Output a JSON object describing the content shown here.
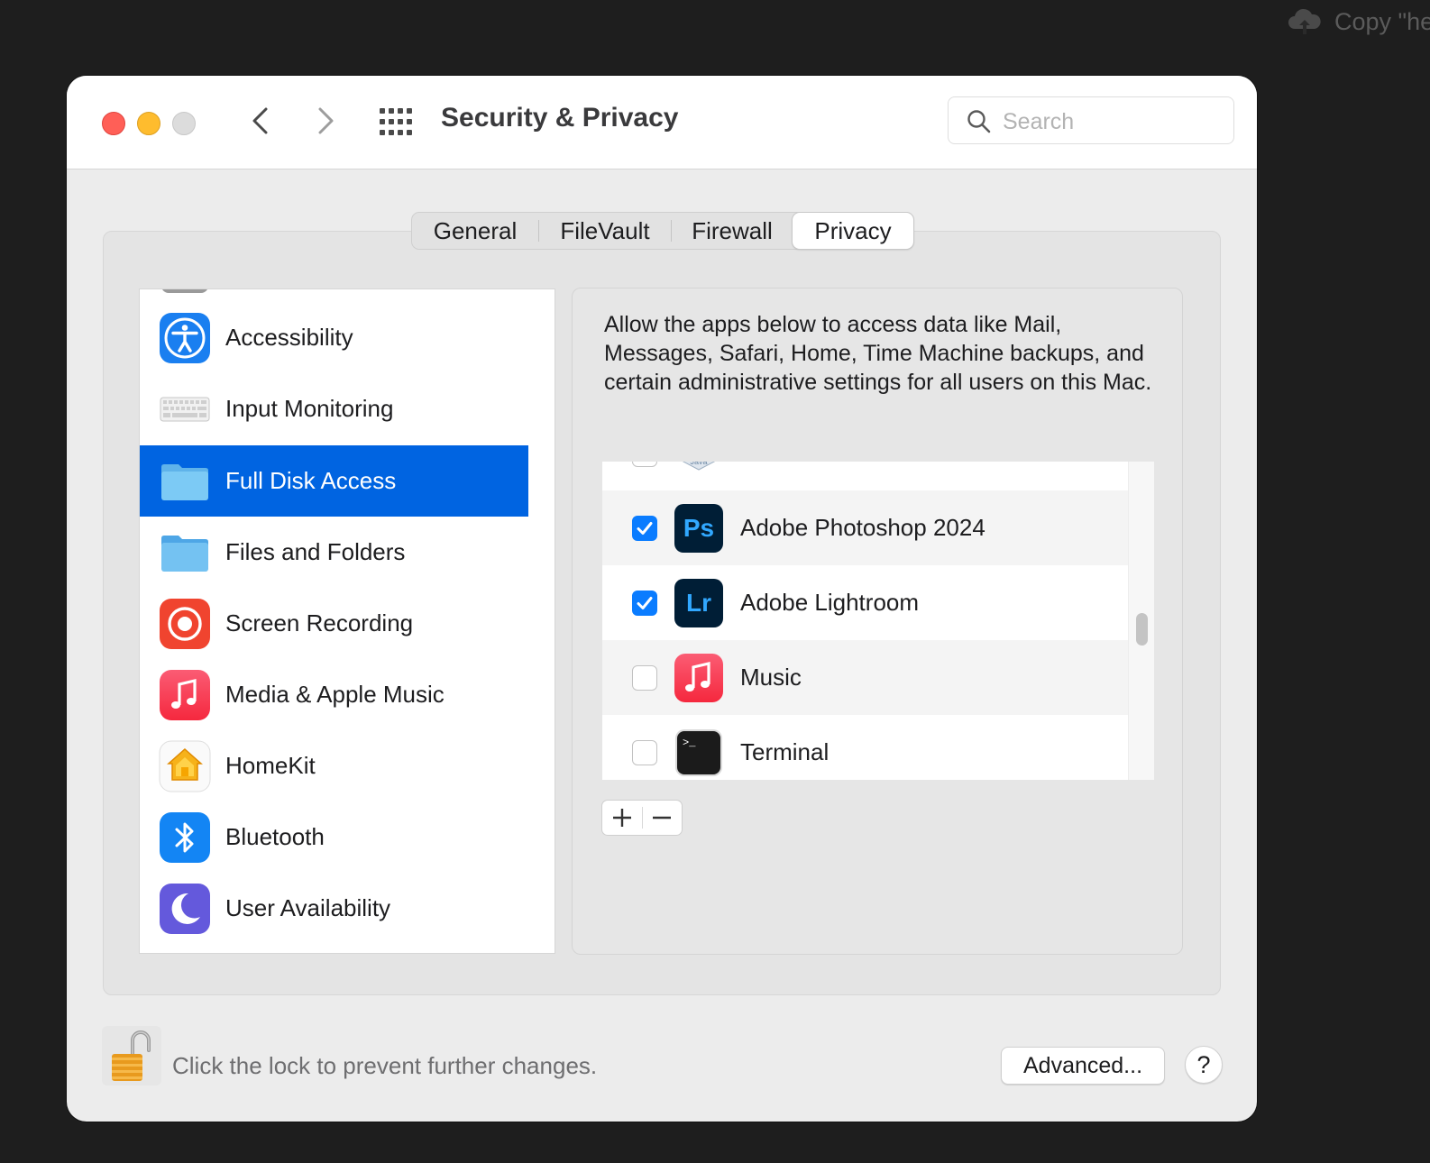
{
  "background": {
    "notice_text": "Copy \"he"
  },
  "window": {
    "title": "Security & Privacy",
    "search": {
      "placeholder": "Search",
      "value": ""
    },
    "tabs": [
      {
        "label": "General",
        "selected": false
      },
      {
        "label": "FileVault",
        "selected": false
      },
      {
        "label": "Firewall",
        "selected": false
      },
      {
        "label": "Privacy",
        "selected": true
      }
    ],
    "categories": [
      {
        "label": "Accessibility",
        "icon": "accessibility-icon"
      },
      {
        "label": "Input Monitoring",
        "icon": "keyboard-icon"
      },
      {
        "label": "Full Disk Access",
        "icon": "folder-icon",
        "selected": true
      },
      {
        "label": "Files and Folders",
        "icon": "folder-icon"
      },
      {
        "label": "Screen Recording",
        "icon": "screen-recording-icon"
      },
      {
        "label": "Media & Apple Music",
        "icon": "music-icon"
      },
      {
        "label": "HomeKit",
        "icon": "homekit-icon"
      },
      {
        "label": "Bluetooth",
        "icon": "bluetooth-icon"
      },
      {
        "label": "User Availability",
        "icon": "moon-icon"
      }
    ],
    "description": "Allow the apps below to access data like Mail, Messages, Safari, Home, Time Machine backups, and certain administrative settings for all users on this Mac.",
    "apps": [
      {
        "name": "Adobe Photoshop 2024",
        "checked": true,
        "icon": "photoshop-icon",
        "icon_text": "Ps"
      },
      {
        "name": "Adobe Lightroom",
        "checked": true,
        "icon": "lightroom-icon",
        "icon_text": "Lr"
      },
      {
        "name": "Music",
        "checked": false,
        "icon": "music-icon"
      },
      {
        "name": "Terminal",
        "checked": false,
        "icon": "terminal-icon",
        "icon_text": ">_"
      }
    ],
    "lock_text": "Click the lock to prevent further changes.",
    "advanced_label": "Advanced...",
    "help_label": "?"
  },
  "colors": {
    "selection": "#0064e1",
    "checkbox_checked": "#0a7cff",
    "close": "#ff5f57",
    "minimize": "#febc2e"
  }
}
